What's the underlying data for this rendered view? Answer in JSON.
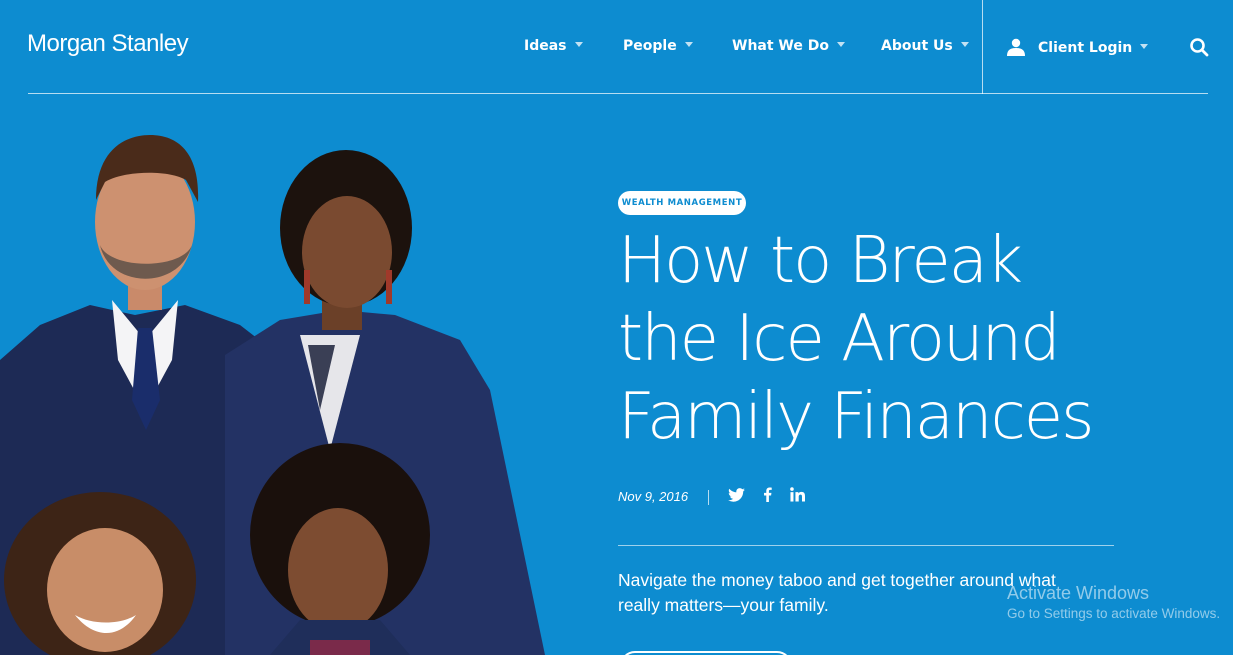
{
  "header": {
    "logo": "Morgan Stanley",
    "nav": [
      {
        "label": "Ideas"
      },
      {
        "label": "People"
      },
      {
        "label": "What We Do"
      },
      {
        "label": "About Us"
      }
    ],
    "client_login": "Client Login"
  },
  "article": {
    "category_badge": "WEALTH MANAGEMENT",
    "headline_lines": [
      "How to Break",
      "the Ice Around",
      "Family Finances"
    ],
    "date": "Nov 9, 2016",
    "social": [
      "twitter-icon",
      "facebook-icon",
      "linkedin-icon"
    ],
    "summary": "Navigate the money taboo and get together around what really matters—your family."
  },
  "os_watermark": {
    "title": "Activate Windows",
    "subtitle": "Go to Settings to activate Windows."
  },
  "colors": {
    "background": "#0d8cd0",
    "text": "#ffffff",
    "suit_navy": "#1d2a55"
  }
}
